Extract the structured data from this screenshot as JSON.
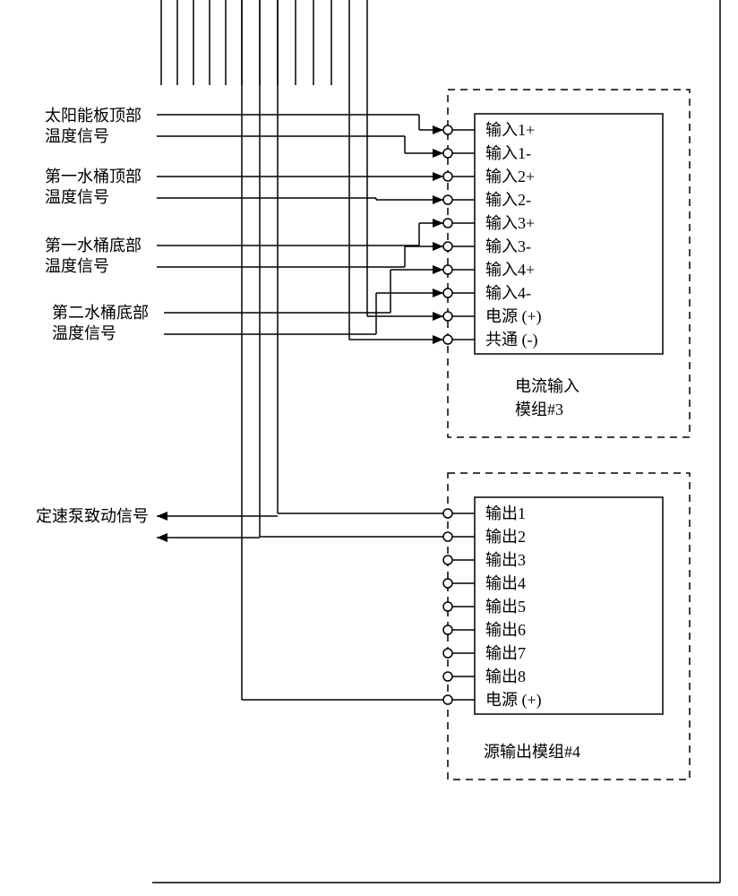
{
  "labels": {
    "solar_top_1": "太阳能板顶部",
    "solar_top_2": "温度信号",
    "tank1_top_1": "第一水桶顶部",
    "tank1_top_2": "温度信号",
    "tank1_bot_1": "第一水桶底部",
    "tank1_bot_2": "温度信号",
    "tank2_bot_1": "第二水桶底部",
    "tank2_bot_2": "温度信号",
    "pump_actuate": "定速泵致动信号"
  },
  "module3": {
    "title_l1": "电流输入",
    "title_l2": "模组#3",
    "pins": [
      "输入1+",
      "输入1-",
      "输入2+",
      "输入2-",
      "输入3+",
      "输入3-",
      "输入4+",
      "输入4-",
      "电源 (+)",
      "共通 (-)"
    ]
  },
  "module4": {
    "title_l1": "源输出模组#4",
    "pins": [
      "输出1",
      "输出2",
      "输出3",
      "输出4",
      "输出5",
      "输出6",
      "输出7",
      "输出8",
      "电源 (+)"
    ]
  }
}
